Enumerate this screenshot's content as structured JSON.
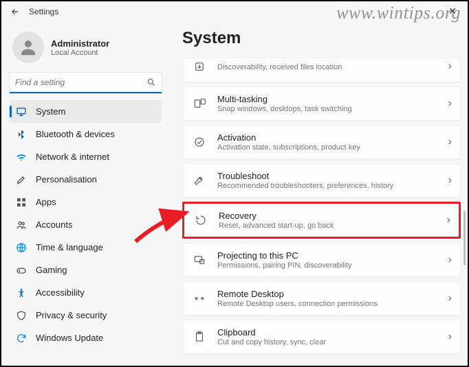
{
  "window": {
    "title": "Settings"
  },
  "watermark": "www.wintips.org",
  "user": {
    "name": "Administrator",
    "sub": "Local Account"
  },
  "search": {
    "placeholder": "Find a setting"
  },
  "nav": {
    "items": [
      {
        "label": "System"
      },
      {
        "label": "Bluetooth & devices"
      },
      {
        "label": "Network & internet"
      },
      {
        "label": "Personalisation"
      },
      {
        "label": "Apps"
      },
      {
        "label": "Accounts"
      },
      {
        "label": "Time & language"
      },
      {
        "label": "Gaming"
      },
      {
        "label": "Accessibility"
      },
      {
        "label": "Privacy & security"
      },
      {
        "label": "Windows Update"
      }
    ]
  },
  "main": {
    "title": "System",
    "cards": [
      {
        "title": "",
        "sub": "Discoverability, received files location"
      },
      {
        "title": "Multi-tasking",
        "sub": "Snap windows, desktops, task switching"
      },
      {
        "title": "Activation",
        "sub": "Activation state, subscriptions, product key"
      },
      {
        "title": "Troubleshoot",
        "sub": "Recommended troubleshooters, preferences, history"
      },
      {
        "title": "Recovery",
        "sub": "Reset, advanced start-up, go back"
      },
      {
        "title": "Projecting to this PC",
        "sub": "Permissions, pairing PIN, discoverability"
      },
      {
        "title": "Remote Desktop",
        "sub": "Remote Desktop users, connection permissions"
      },
      {
        "title": "Clipboard",
        "sub": "Cut and copy history, sync, clear"
      }
    ]
  }
}
